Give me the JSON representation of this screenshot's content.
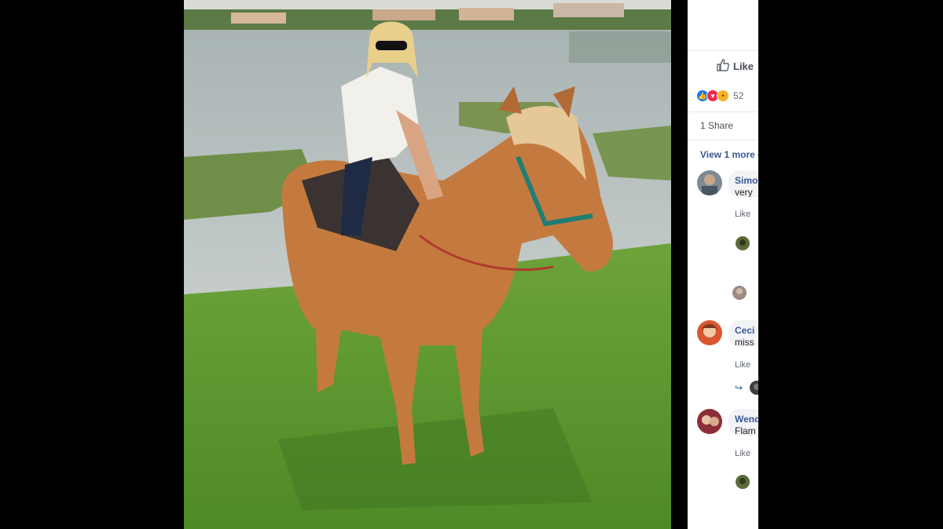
{
  "post": {
    "like_label": "Like",
    "reaction_count": "52",
    "share_text": "1 Share",
    "view_more_text": "View 1 more c"
  },
  "comments": [
    {
      "name": "Simo",
      "text": "very",
      "like_label": "Like"
    },
    {
      "name": "Ceci",
      "text": "miss",
      "like_label": "Like"
    },
    {
      "name": "Wend",
      "text": "Flam",
      "like_label": "Like"
    }
  ],
  "icons": {
    "like": "thumbs-up-icon",
    "reaction_like": "like-reaction-icon",
    "reaction_love": "love-reaction-icon",
    "reaction_wow": "wow-reaction-icon",
    "reply": "reply-arrow-icon"
  },
  "colors": {
    "link_blue": "#385898",
    "facebook_blue": "#1877f2",
    "love_red": "#f0284a",
    "wow_yellow": "#f7b125"
  }
}
